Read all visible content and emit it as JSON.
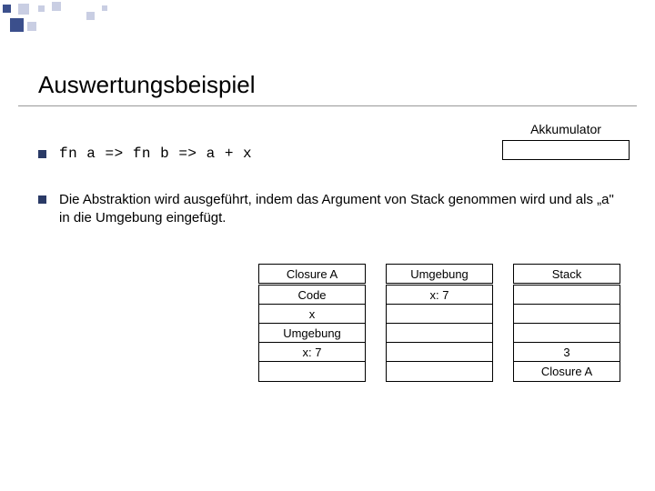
{
  "title": "Auswertungsbeispiel",
  "akk": {
    "label": "Akkumulator"
  },
  "bullet1": {
    "code": "fn a => fn b => a + x"
  },
  "bullet2": {
    "text": "Die Abstraktion wird ausgeführt, indem das Argument von Stack genommen wird und als „a\" in die Umgebung eingefügt."
  },
  "closureA": {
    "header": "Closure A",
    "rows": [
      "Code",
      "x",
      "Umgebung",
      "x: 7",
      ""
    ]
  },
  "umgebung": {
    "header": "Umgebung",
    "rows": [
      "x: 7",
      "",
      "",
      "",
      ""
    ]
  },
  "stack": {
    "header": "Stack",
    "rows": [
      "",
      "",
      "",
      "3",
      "Closure A"
    ]
  }
}
